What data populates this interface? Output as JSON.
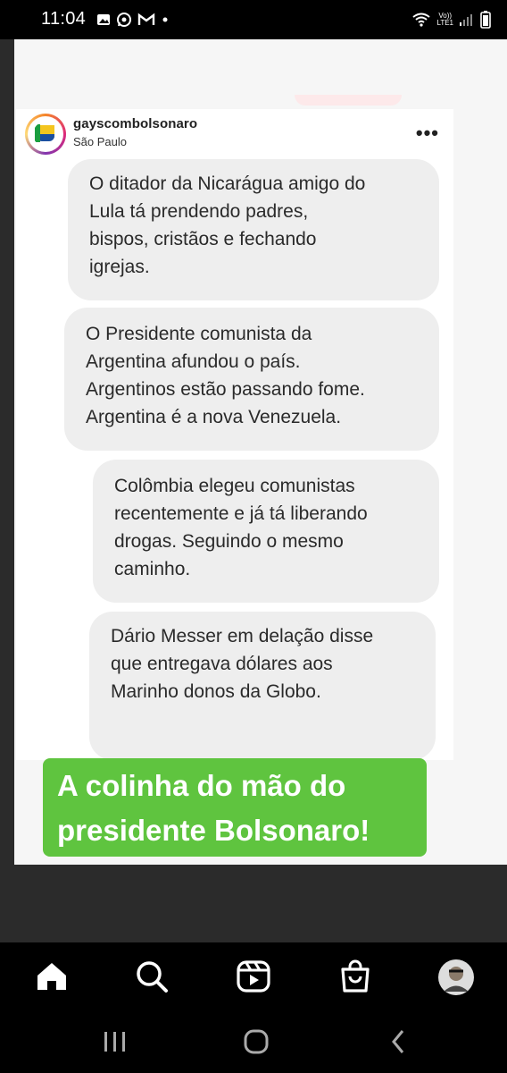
{
  "status_bar": {
    "time": "11:04",
    "left_icons": [
      "image-icon",
      "whatsapp-icon",
      "gmail-icon",
      "dot-icon"
    ],
    "network_label_top": "Vo))",
    "network_label_bottom": "LTE1"
  },
  "post": {
    "username": "gayscombolsonaro",
    "location": "São Paulo",
    "menu": "•••",
    "messages": [
      "O ditador da Nicarágua amigo do\nLula tá prendendo padres,\nbispos, cristãos e fechando\nigrejas.",
      "O Presidente comunista da\nArgentina afundou o país.\nArgentinos estão passando fome.\nArgentina é a nova Venezuela.",
      "Colômbia elegeu comunistas\nrecentemente e já tá liberando\ndrogas. Seguindo o mesmo\ncaminho.",
      "Dário Messer em delação disse\nque entregava dólares aos\nMarinho donos da Globo."
    ]
  },
  "caption": "A colinha do mão do\npresidente Bolsonaro!",
  "bottom_nav": [
    "home-icon",
    "search-icon",
    "reels-icon",
    "shop-icon",
    "profile-avatar"
  ],
  "system_nav": [
    "recents-button",
    "home-button",
    "back-button"
  ],
  "colors": {
    "caption_bg": "#5fc43f",
    "bubble_bg": "#eeeeee",
    "card_bg": "#f6f6f6"
  }
}
